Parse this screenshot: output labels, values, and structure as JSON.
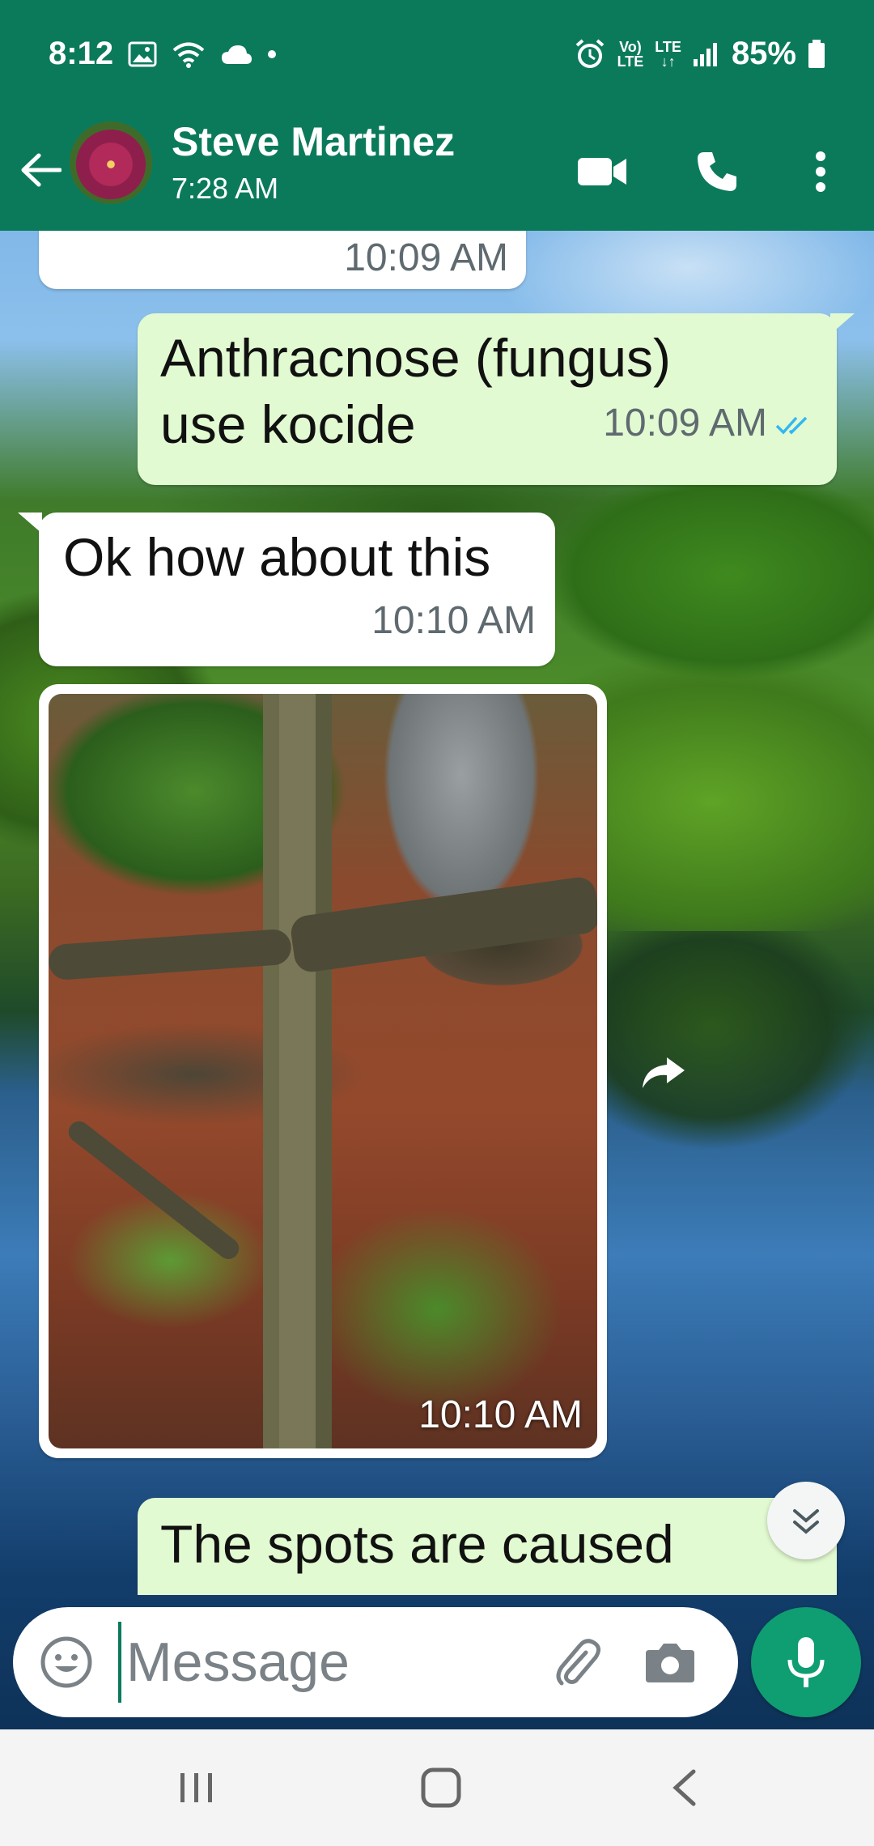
{
  "status_bar": {
    "time": "8:12",
    "volte_top": "Vo)",
    "volte_bottom": "LTE",
    "lte_top": "LTE",
    "lte_bottom": "↓↑",
    "battery": "85%"
  },
  "header": {
    "contact_name": "Steve Martinez",
    "subtitle": "7:28 AM"
  },
  "messages": [
    {
      "direction": "incoming",
      "text": "",
      "time": "10:09 AM"
    },
    {
      "direction": "outgoing",
      "text": "Anthracnose (fungus) use kocide",
      "time": "10:09 AM",
      "read": true
    },
    {
      "direction": "incoming",
      "text": "Ok how about this",
      "time": "10:10 AM"
    },
    {
      "direction": "incoming",
      "type": "image",
      "time": "10:10 AM"
    },
    {
      "direction": "outgoing",
      "text": "The spots are caused",
      "time": ""
    }
  ],
  "composer": {
    "placeholder": "Message"
  },
  "colors": {
    "header": "#0b7a5b",
    "outgoing_bubble": "#e2fad1",
    "mic_button": "#0f9d72",
    "read_ticks": "#34b7f1"
  },
  "icons": [
    "back-arrow-icon",
    "video-call-icon",
    "phone-icon",
    "more-options-icon",
    "forward-icon",
    "scroll-down-icon",
    "emoji-icon",
    "attach-icon",
    "camera-icon",
    "mic-icon",
    "recents-icon",
    "home-icon",
    "back-nav-icon"
  ]
}
